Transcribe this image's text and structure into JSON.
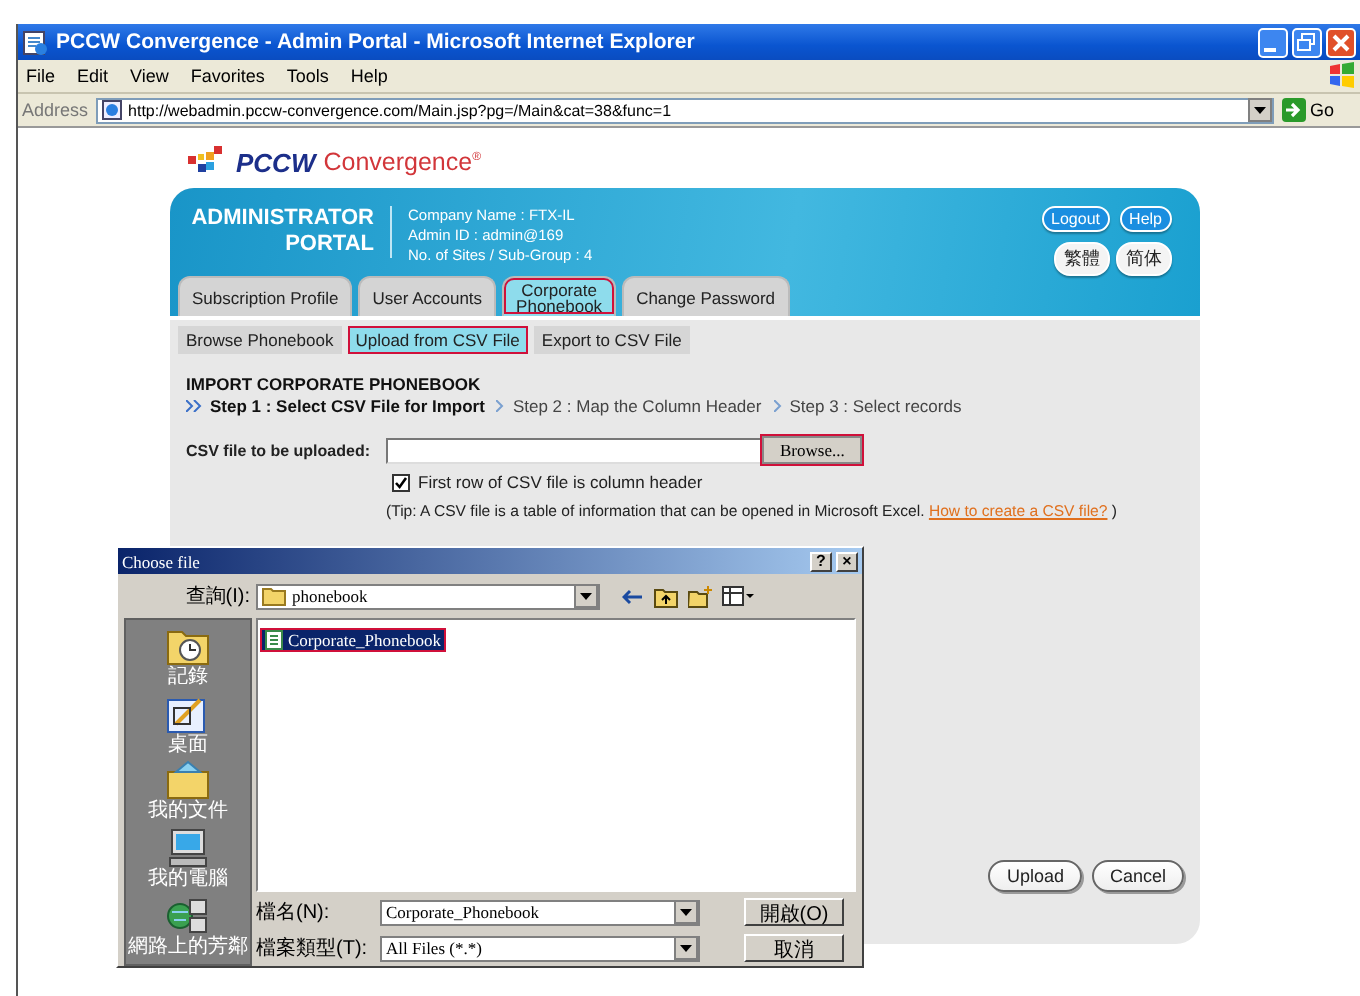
{
  "window": {
    "title": "PCCW Convergence - Admin Portal - Microsoft Internet Explorer",
    "menu": [
      "File",
      "Edit",
      "View",
      "Favorites",
      "Tools",
      "Help"
    ],
    "address_label": "Address",
    "url": "http://webadmin.pccw-convergence.com/Main.jsp?pg=/Main&cat=38&func=1",
    "go": "Go"
  },
  "logo": {
    "brand": "PCCW",
    "name": "Convergence$^{®}$"
  },
  "portal": {
    "title": [
      "ADMINISTRATOR",
      "PORTAL"
    ],
    "info": [
      "Company Name : FTX-IL",
      "Admin ID : admin@169",
      "No. of Sites / Sub-Group : 4"
    ],
    "top_buttons": [
      {
        "label": "Logout",
        "kind": "blue"
      },
      {
        "label": "Help",
        "kind": "blue"
      },
      {
        "label": "繁體",
        "kind": "white"
      },
      {
        "label": "简体",
        "kind": "white"
      }
    ],
    "tabs": [
      {
        "label": "Subscription Profile",
        "selected": false,
        "highlighted": false
      },
      {
        "label": "User Accounts",
        "selected": false,
        "highlighted": false
      },
      {
        "label": "Corporate\nPhonebook",
        "selected": true,
        "highlighted": true
      },
      {
        "label": "Change Password",
        "selected": false,
        "highlighted": false
      }
    ],
    "subtabs": [
      {
        "label": "Browse Phonebook",
        "selected": false,
        "highlighted": false
      },
      {
        "label": "Upload from CSV File",
        "selected": true,
        "highlighted": true
      },
      {
        "label": "Export to CSV File",
        "selected": false,
        "highlighted": false
      }
    ],
    "heading": "IMPORT CORPORATE PHONEBOOK",
    "steps": [
      {
        "label": "Step 1 : Select CSV File for Import",
        "current": true
      },
      {
        "label": "Step 2 : Map the Column Header",
        "current": false
      },
      {
        "label": "Step 3 : Select records",
        "current": false
      }
    ],
    "file_field": {
      "label": "CSV file to be uploaded:",
      "button": "Browse...",
      "button_highlighted": true
    },
    "header_option": {
      "label": "First row of CSV file is column header",
      "checked": true
    },
    "tip": {
      "text": "(Tip: A CSV file is a table of information that can be opened in Microsoft Excel.",
      "link": "How to create a CSV file?",
      "end": ")"
    },
    "actions": [
      "Upload",
      "Cancel"
    ]
  },
  "dialog": {
    "title": "Choose file",
    "title_buttons": [
      "?",
      "×"
    ],
    "look_in_label": "查詢(I):",
    "folder": "phonebook",
    "places": [
      "記錄",
      "桌面",
      "我的文件",
      "我的電腦",
      "網路上的芳鄰"
    ],
    "files": [
      {
        "name": "Corporate_Phonebook",
        "selected": true,
        "highlighted": true
      }
    ],
    "filename_label": "檔名(N):",
    "filename": "Corporate_Phonebook",
    "filetype_label": "檔案類型(T):",
    "filetype": "All Files (*.*)",
    "buttons": [
      "開啟(O)",
      "取消"
    ]
  }
}
